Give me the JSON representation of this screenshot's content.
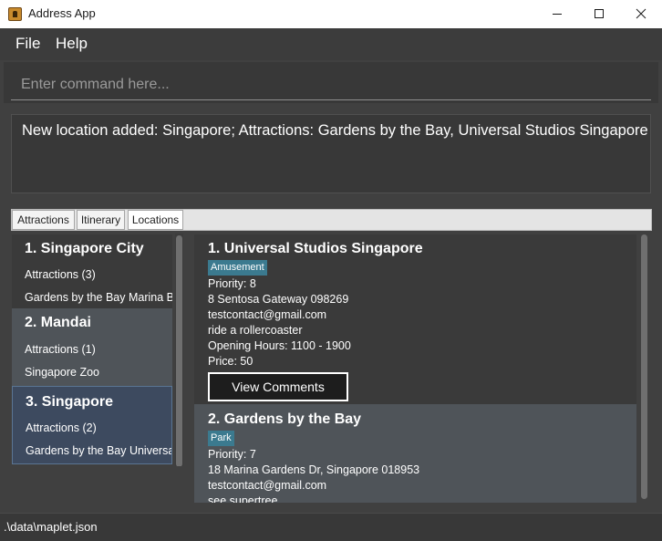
{
  "window": {
    "title": "Address App",
    "app_icon": "address-book-icon"
  },
  "menu": {
    "items": [
      "File",
      "Help"
    ]
  },
  "command": {
    "placeholder": "Enter command here...",
    "value": ""
  },
  "result": {
    "message": "New location added: Singapore; Attractions: Gardens by the Bay, Universal Studios Singapore"
  },
  "tabs": {
    "items": [
      "Attractions",
      "Itinerary",
      "Locations"
    ],
    "active": "Locations"
  },
  "locations": [
    {
      "title": "1. Singapore City",
      "attractions_label": "Attractions (3)",
      "attractions_list": "Gardens by the Bay  Marina B"
    },
    {
      "title": "2. Mandai",
      "attractions_label": "Attractions (1)",
      "attractions_list": "Singapore Zoo"
    },
    {
      "title": "3. Singapore",
      "attractions_label": "Attractions (2)",
      "attractions_list": "Gardens by the Bay  Universal S"
    }
  ],
  "attractions": [
    {
      "title": "1. Universal Studios Singapore",
      "tag": "Amusement",
      "tag_color": "#3b7a8f",
      "priority": "Priority: 8",
      "address": "8 Sentosa Gateway 098269",
      "email": "testcontact@gmail.com",
      "description": "ride a rollercoaster",
      "hours": "Opening Hours: 1100 - 1900",
      "price": "Price: 50",
      "button": "View Comments"
    },
    {
      "title": "2. Gardens by the Bay",
      "tag": "Park",
      "tag_color": "#3b7a8f",
      "priority": "Priority: 7",
      "address": "18 Marina Gardens Dr, Singapore 018953",
      "email": "testcontact@gmail.com",
      "description": "see supertree"
    }
  ],
  "status": {
    "path": ".\\data\\maplet.json"
  },
  "colors": {
    "background": "#404040",
    "selected_card": "#3d4a5f",
    "tag": "#3b7a8f"
  }
}
